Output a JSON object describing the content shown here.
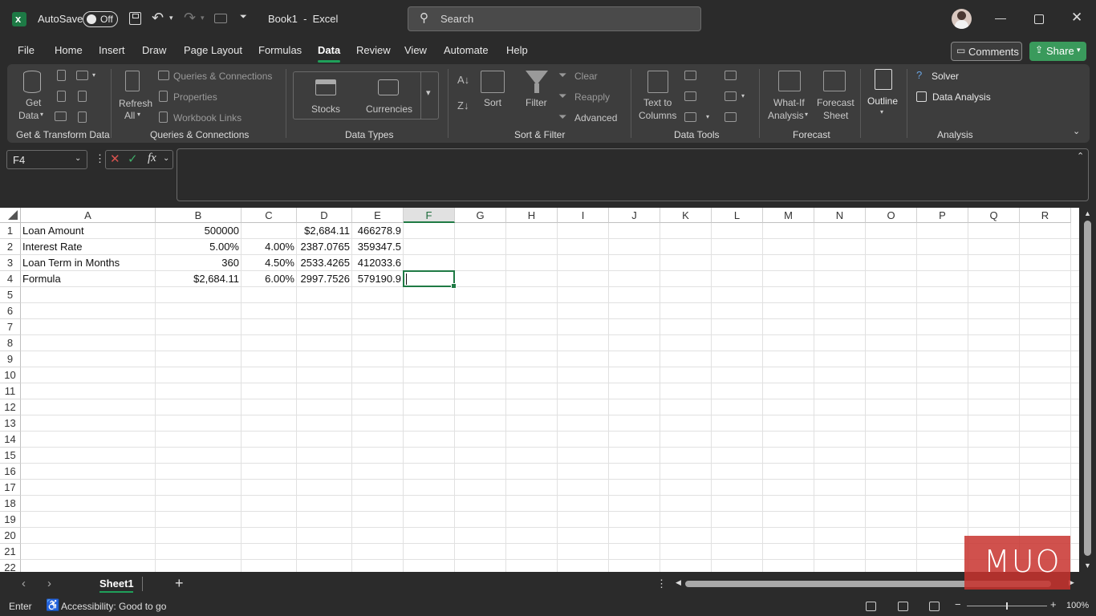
{
  "titlebar": {
    "autosave_label": "AutoSave",
    "autosave_state": "Off",
    "doc_title": "Book1  -  Excel",
    "search_placeholder": "Search"
  },
  "menu": {
    "items": [
      "File",
      "Home",
      "Insert",
      "Draw",
      "Page Layout",
      "Formulas",
      "Data",
      "Review",
      "View",
      "Automate",
      "Help"
    ],
    "active": "Data",
    "comments_label": "Comments",
    "share_label": "Share"
  },
  "ribbon": {
    "get_data": "Get\nData",
    "get_data_line1": "Get",
    "get_data_line2": "Data",
    "refresh_line1": "Refresh",
    "refresh_line2": "All",
    "queries_connections": "Queries & Connections",
    "properties": "Properties",
    "workbook_links": "Workbook Links",
    "stocks": "Stocks",
    "currencies": "Currencies",
    "sort": "Sort",
    "filter": "Filter",
    "clear": "Clear",
    "reapply": "Reapply",
    "advanced": "Advanced",
    "text_to_columns_1": "Text to",
    "text_to_columns_2": "Columns",
    "what_if_1": "What-If",
    "what_if_2": "Analysis",
    "forecast_sheet_1": "Forecast",
    "forecast_sheet_2": "Sheet",
    "outline": "Outline",
    "solver": "Solver",
    "data_analysis": "Data Analysis",
    "groups": {
      "get_transform": "Get & Transform Data",
      "queries": "Queries & Connections",
      "data_types": "Data Types",
      "sort_filter": "Sort & Filter",
      "data_tools": "Data Tools",
      "forecast": "Forecast",
      "analysis": "Analysis"
    }
  },
  "formula_bar": {
    "name_box": "F4",
    "content": ""
  },
  "sheet": {
    "columns": [
      "A",
      "B",
      "C",
      "D",
      "E",
      "F",
      "G",
      "H",
      "I",
      "J",
      "K",
      "L",
      "M",
      "N",
      "O",
      "P",
      "Q",
      "R"
    ],
    "selected_column": "F",
    "selected_cell": "F4",
    "rows": [
      "1",
      "2",
      "3",
      "4",
      "5",
      "6",
      "7",
      "8",
      "9",
      "10",
      "11",
      "12",
      "13",
      "14",
      "15",
      "16",
      "17",
      "18",
      "19",
      "20",
      "21",
      "22"
    ],
    "cells": {
      "A1": "Loan Amount",
      "B1": "500000",
      "D1": "$2,684.11",
      "E1": "466278.9",
      "A2": "Interest Rate",
      "B2": "5.00%",
      "C2": "4.00%",
      "D2": "2387.0765",
      "E2": "359347.5",
      "A3": "Loan Term in Months",
      "B3": "360",
      "C3": "4.50%",
      "D3": "2533.4265",
      "E3": "412033.6",
      "A4": "Formula",
      "B4": "$2,684.11",
      "C4": "6.00%",
      "D4": "2997.7526",
      "E4": "579190.9"
    }
  },
  "tabs": {
    "sheets": [
      "Sheet1"
    ],
    "active": "Sheet1"
  },
  "status": {
    "mode": "Enter",
    "accessibility": "Accessibility: Good to go",
    "zoom": "100%"
  },
  "watermark": "MUO",
  "colors": {
    "accent": "#1fa05a",
    "selection": "#1f7a44",
    "share_bg": "#3a9a5c",
    "watermark_bg": "#c8322e"
  }
}
